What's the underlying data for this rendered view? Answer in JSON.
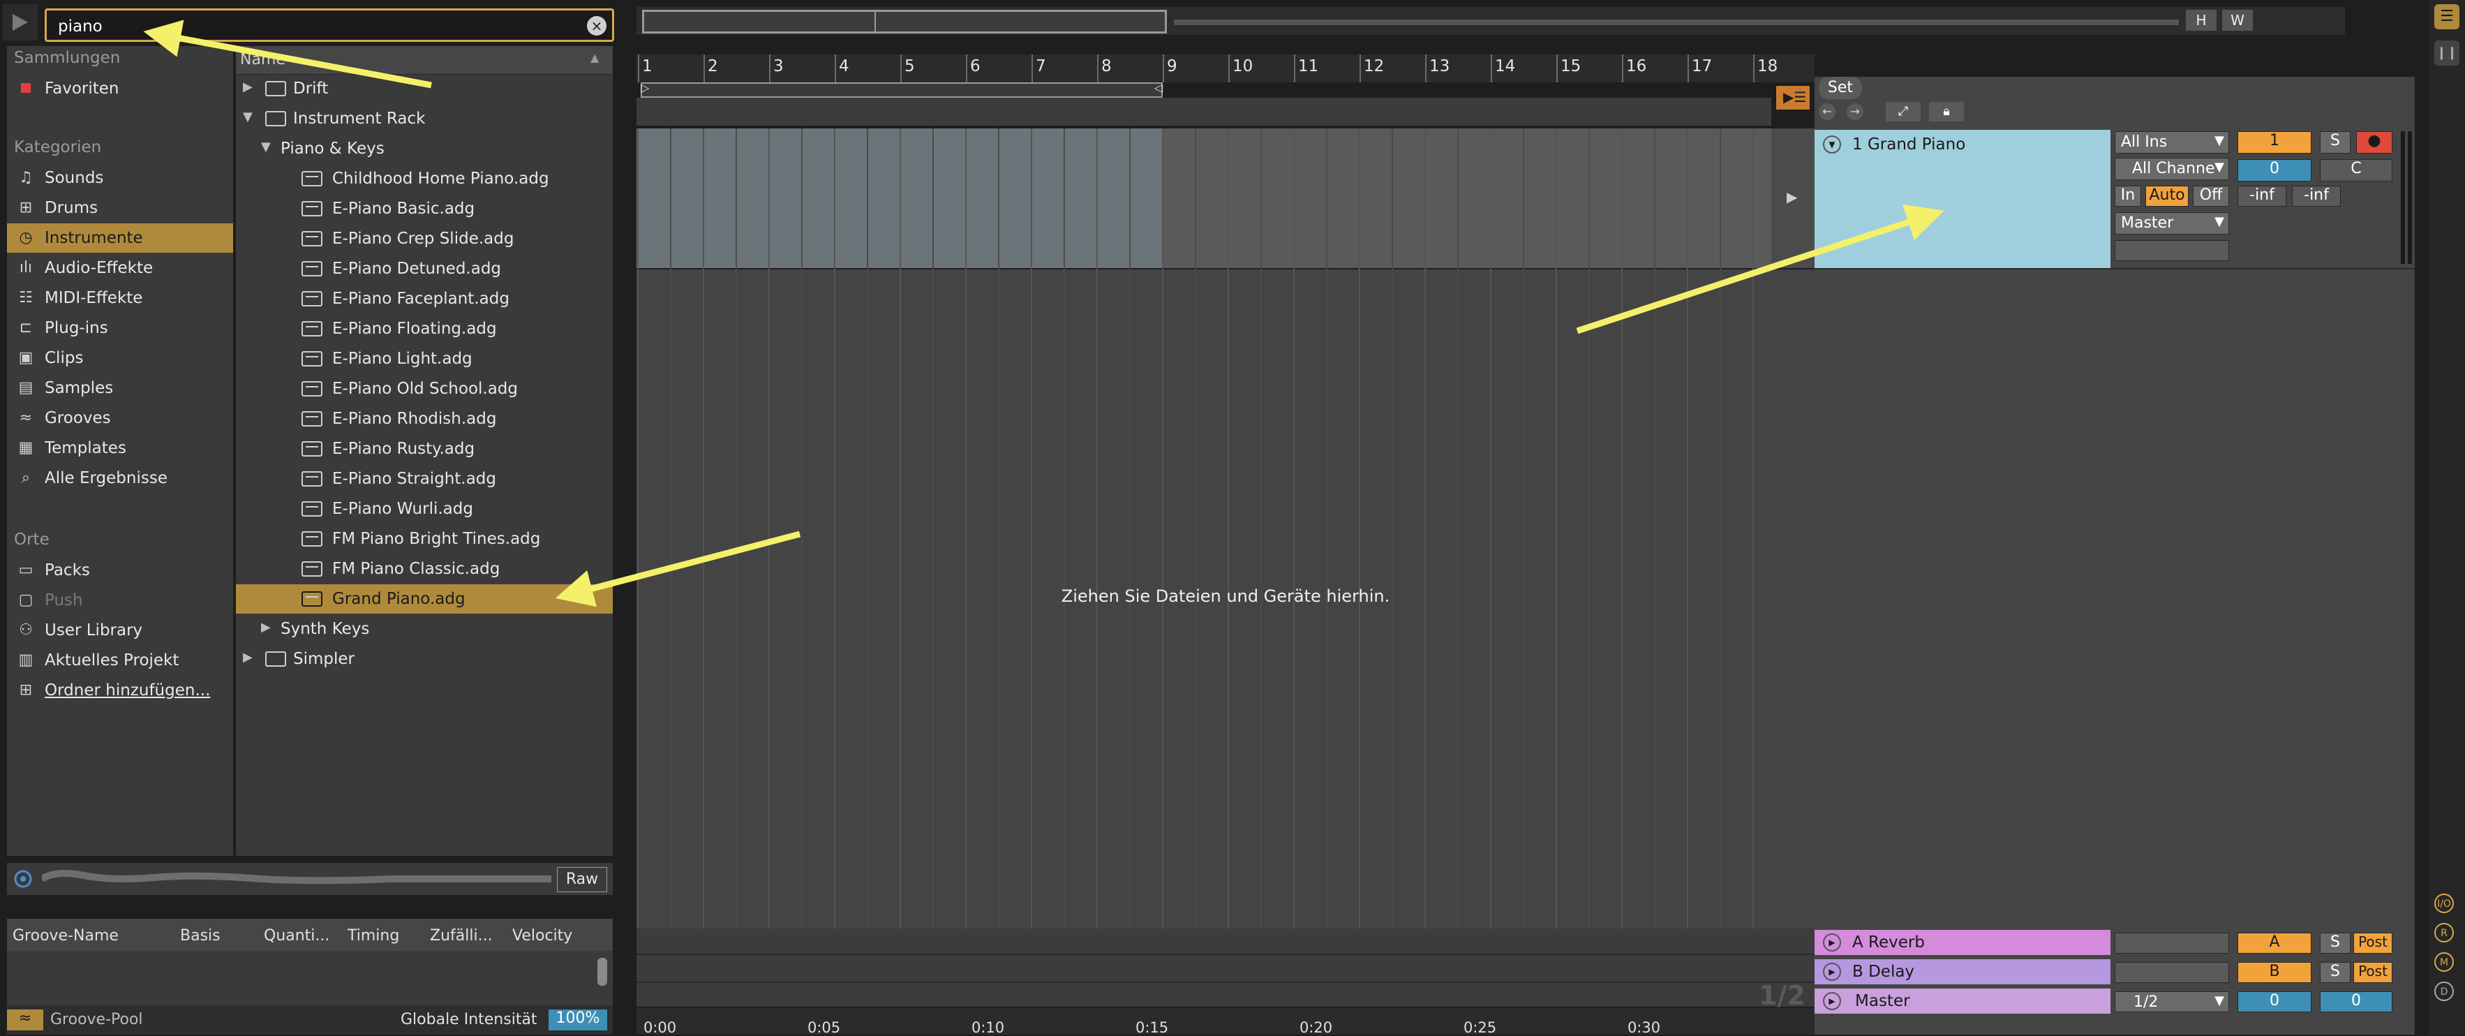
{
  "browser": {
    "search_value": "piano",
    "sections": {
      "collections": "Sammlungen",
      "categories": "Kategorien",
      "places": "Orte"
    },
    "collections": [
      {
        "label": "Favoriten",
        "icon": "red-square-icon"
      }
    ],
    "categories": [
      {
        "label": "Sounds",
        "icon": "note-icon"
      },
      {
        "label": "Drums",
        "icon": "drums-grid-icon"
      },
      {
        "label": "Instrumente",
        "icon": "instrument-clock-icon",
        "selected": true
      },
      {
        "label": "Audio-Effekte",
        "icon": "audio-fx-icon"
      },
      {
        "label": "MIDI-Effekte",
        "icon": "midi-fx-icon"
      },
      {
        "label": "Plug-ins",
        "icon": "plugin-icon"
      },
      {
        "label": "Clips",
        "icon": "clip-icon"
      },
      {
        "label": "Samples",
        "icon": "sample-icon"
      },
      {
        "label": "Grooves",
        "icon": "groove-icon"
      },
      {
        "label": "Templates",
        "icon": "template-icon"
      },
      {
        "label": "Alle Ergebnisse",
        "icon": "search-icon"
      }
    ],
    "places": [
      {
        "label": "Packs",
        "icon": "packs-icon"
      },
      {
        "label": "Push",
        "icon": "push-icon",
        "dim": true
      },
      {
        "label": "User Library",
        "icon": "user-icon"
      },
      {
        "label": "Aktuelles Projekt",
        "icon": "project-icon"
      },
      {
        "label": "Ordner hinzufügen...",
        "icon": "add-folder-icon"
      }
    ],
    "list_header": "Name",
    "items": [
      {
        "label": "Drift",
        "level": 0,
        "tri": "▶",
        "kind": "device"
      },
      {
        "label": "Instrument Rack",
        "level": 0,
        "tri": "▼",
        "kind": "device"
      },
      {
        "label": "Piano & Keys",
        "level": 1,
        "tri": "▼",
        "kind": "folder"
      },
      {
        "label": "Childhood Home Piano.adg",
        "level": 2,
        "kind": "preset"
      },
      {
        "label": "E-Piano Basic.adg",
        "level": 2,
        "kind": "preset"
      },
      {
        "label": "E-Piano Crep Slide.adg",
        "level": 2,
        "kind": "preset"
      },
      {
        "label": "E-Piano Detuned.adg",
        "level": 2,
        "kind": "preset"
      },
      {
        "label": "E-Piano Faceplant.adg",
        "level": 2,
        "kind": "preset"
      },
      {
        "label": "E-Piano Floating.adg",
        "level": 2,
        "kind": "preset"
      },
      {
        "label": "E-Piano Light.adg",
        "level": 2,
        "kind": "preset"
      },
      {
        "label": "E-Piano Old School.adg",
        "level": 2,
        "kind": "preset"
      },
      {
        "label": "E-Piano Rhodish.adg",
        "level": 2,
        "kind": "preset"
      },
      {
        "label": "E-Piano Rusty.adg",
        "level": 2,
        "kind": "preset"
      },
      {
        "label": "E-Piano Straight.adg",
        "level": 2,
        "kind": "preset"
      },
      {
        "label": "E-Piano Wurli.adg",
        "level": 2,
        "kind": "preset"
      },
      {
        "label": "FM Piano Bright Tines.adg",
        "level": 2,
        "kind": "preset"
      },
      {
        "label": "FM Piano Classic.adg",
        "level": 2,
        "kind": "preset"
      },
      {
        "label": "Grand Piano.adg",
        "level": 2,
        "kind": "preset",
        "selected": true
      },
      {
        "label": "Synth Keys",
        "level": 1,
        "tri": "▶",
        "kind": "folder"
      },
      {
        "label": "Simpler",
        "level": 0,
        "tri": "▶",
        "kind": "device"
      }
    ],
    "raw_label": "Raw"
  },
  "groove": {
    "columns": [
      "Groove-Name",
      "Basis",
      "Quanti...",
      "Timing",
      "Zufälli...",
      "Velocity"
    ],
    "pool_label": "Groove-Pool",
    "global_intensity_label": "Globale Intensität",
    "global_intensity_value": "100%"
  },
  "arrangement": {
    "bars": [
      "1",
      "2",
      "3",
      "4",
      "5",
      "6",
      "7",
      "8",
      "9",
      "10",
      "11",
      "12",
      "13",
      "14",
      "15",
      "16",
      "17",
      "18"
    ],
    "drop_hint": "Ziehen Sie Dateien und Geräte hierhin.",
    "time_labels": [
      "0:00",
      "0:05",
      "0:10",
      "0:15",
      "0:20",
      "0:25",
      "0:30"
    ],
    "set_label": "Set",
    "h_label": "H",
    "w_label": "W",
    "page_indicator": "1/2"
  },
  "tracks": {
    "main": {
      "name": "1 Grand Piano",
      "input_type": "All Ins",
      "input_channel": "All Channe",
      "monitor": [
        "In",
        "Auto",
        "Off"
      ],
      "output": "Master",
      "number": "1",
      "solo": "S",
      "volume": "0",
      "pan": "C",
      "meter_left": "-inf",
      "meter_right": "-inf",
      "color": "#9fcfdc"
    },
    "returns": [
      {
        "name": "A Reverb",
        "letter": "A",
        "solo": "S",
        "post": "Post",
        "color": "#d58bdc"
      },
      {
        "name": "B Delay",
        "letter": "B",
        "solo": "S",
        "post": "Post",
        "color": "#b598e0"
      }
    ],
    "master": {
      "name": "Master",
      "output": "1/2",
      "volume": "0",
      "pan": "0",
      "color": "#c9a0dc"
    }
  },
  "right_edge": [
    "I/O",
    "R",
    "M",
    "D"
  ],
  "colors": {
    "accent": "#d7a94b",
    "selected_bg": "#b08a3c",
    "annotation_arrow": "#f5f06a"
  }
}
